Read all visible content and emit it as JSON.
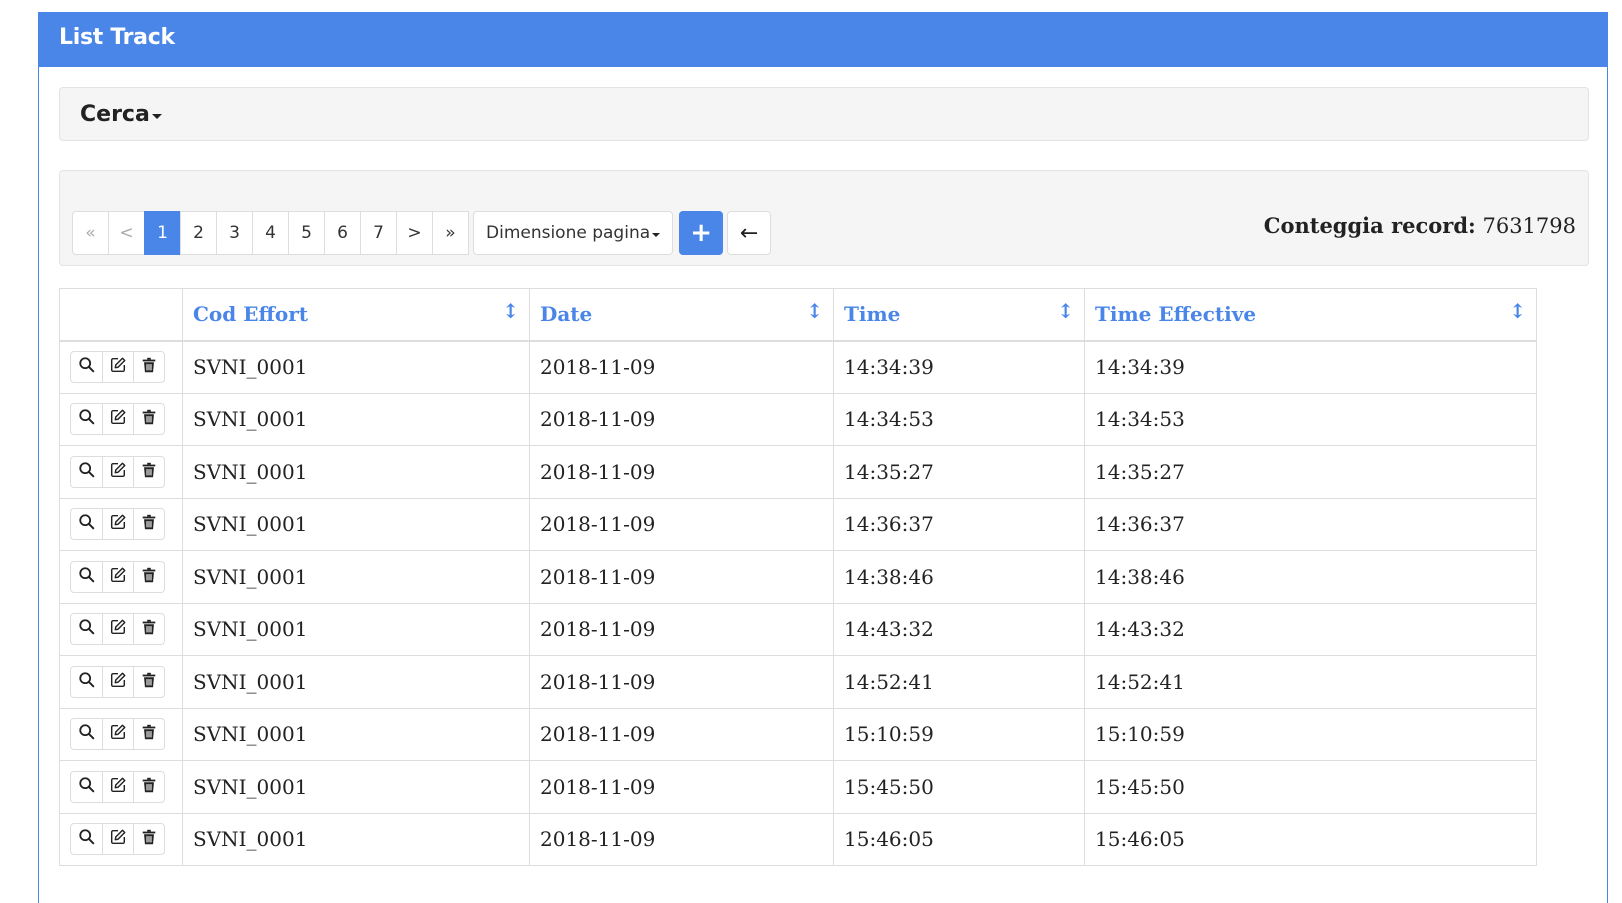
{
  "panel": {
    "title": "List Track"
  },
  "search": {
    "label": "Cerca"
  },
  "pagination": {
    "first": "«",
    "prev": "<",
    "pages": [
      "1",
      "2",
      "3",
      "4",
      "5",
      "6",
      "7"
    ],
    "active_page": "1",
    "next": ">",
    "last": "»",
    "page_size_label": "Dimensione pagina",
    "add_label": "+",
    "back_label": "←"
  },
  "record_count": {
    "label": "Conteggia record:",
    "value": "7631798"
  },
  "table": {
    "columns": [
      "Cod Effort",
      "Date",
      "Time",
      "Time Effective"
    ],
    "sort_icon": "↕",
    "action_icons": [
      "search-icon",
      "edit-icon",
      "trash-icon"
    ],
    "rows": [
      {
        "cod": "SVNI_0001",
        "date": "2018-11-09",
        "time": "14:34:39",
        "time_eff": "14:34:39"
      },
      {
        "cod": "SVNI_0001",
        "date": "2018-11-09",
        "time": "14:34:53",
        "time_eff": "14:34:53"
      },
      {
        "cod": "SVNI_0001",
        "date": "2018-11-09",
        "time": "14:35:27",
        "time_eff": "14:35:27"
      },
      {
        "cod": "SVNI_0001",
        "date": "2018-11-09",
        "time": "14:36:37",
        "time_eff": "14:36:37"
      },
      {
        "cod": "SVNI_0001",
        "date": "2018-11-09",
        "time": "14:38:46",
        "time_eff": "14:38:46"
      },
      {
        "cod": "SVNI_0001",
        "date": "2018-11-09",
        "time": "14:43:32",
        "time_eff": "14:43:32"
      },
      {
        "cod": "SVNI_0001",
        "date": "2018-11-09",
        "time": "14:52:41",
        "time_eff": "14:52:41"
      },
      {
        "cod": "SVNI_0001",
        "date": "2018-11-09",
        "time": "15:10:59",
        "time_eff": "15:10:59"
      },
      {
        "cod": "SVNI_0001",
        "date": "2018-11-09",
        "time": "15:45:50",
        "time_eff": "15:45:50"
      },
      {
        "cod": "SVNI_0001",
        "date": "2018-11-09",
        "time": "15:46:05",
        "time_eff": "15:46:05"
      }
    ]
  },
  "colors": {
    "accent": "#4a86e8",
    "well": "#f5f5f5",
    "border": "#dddddd"
  }
}
